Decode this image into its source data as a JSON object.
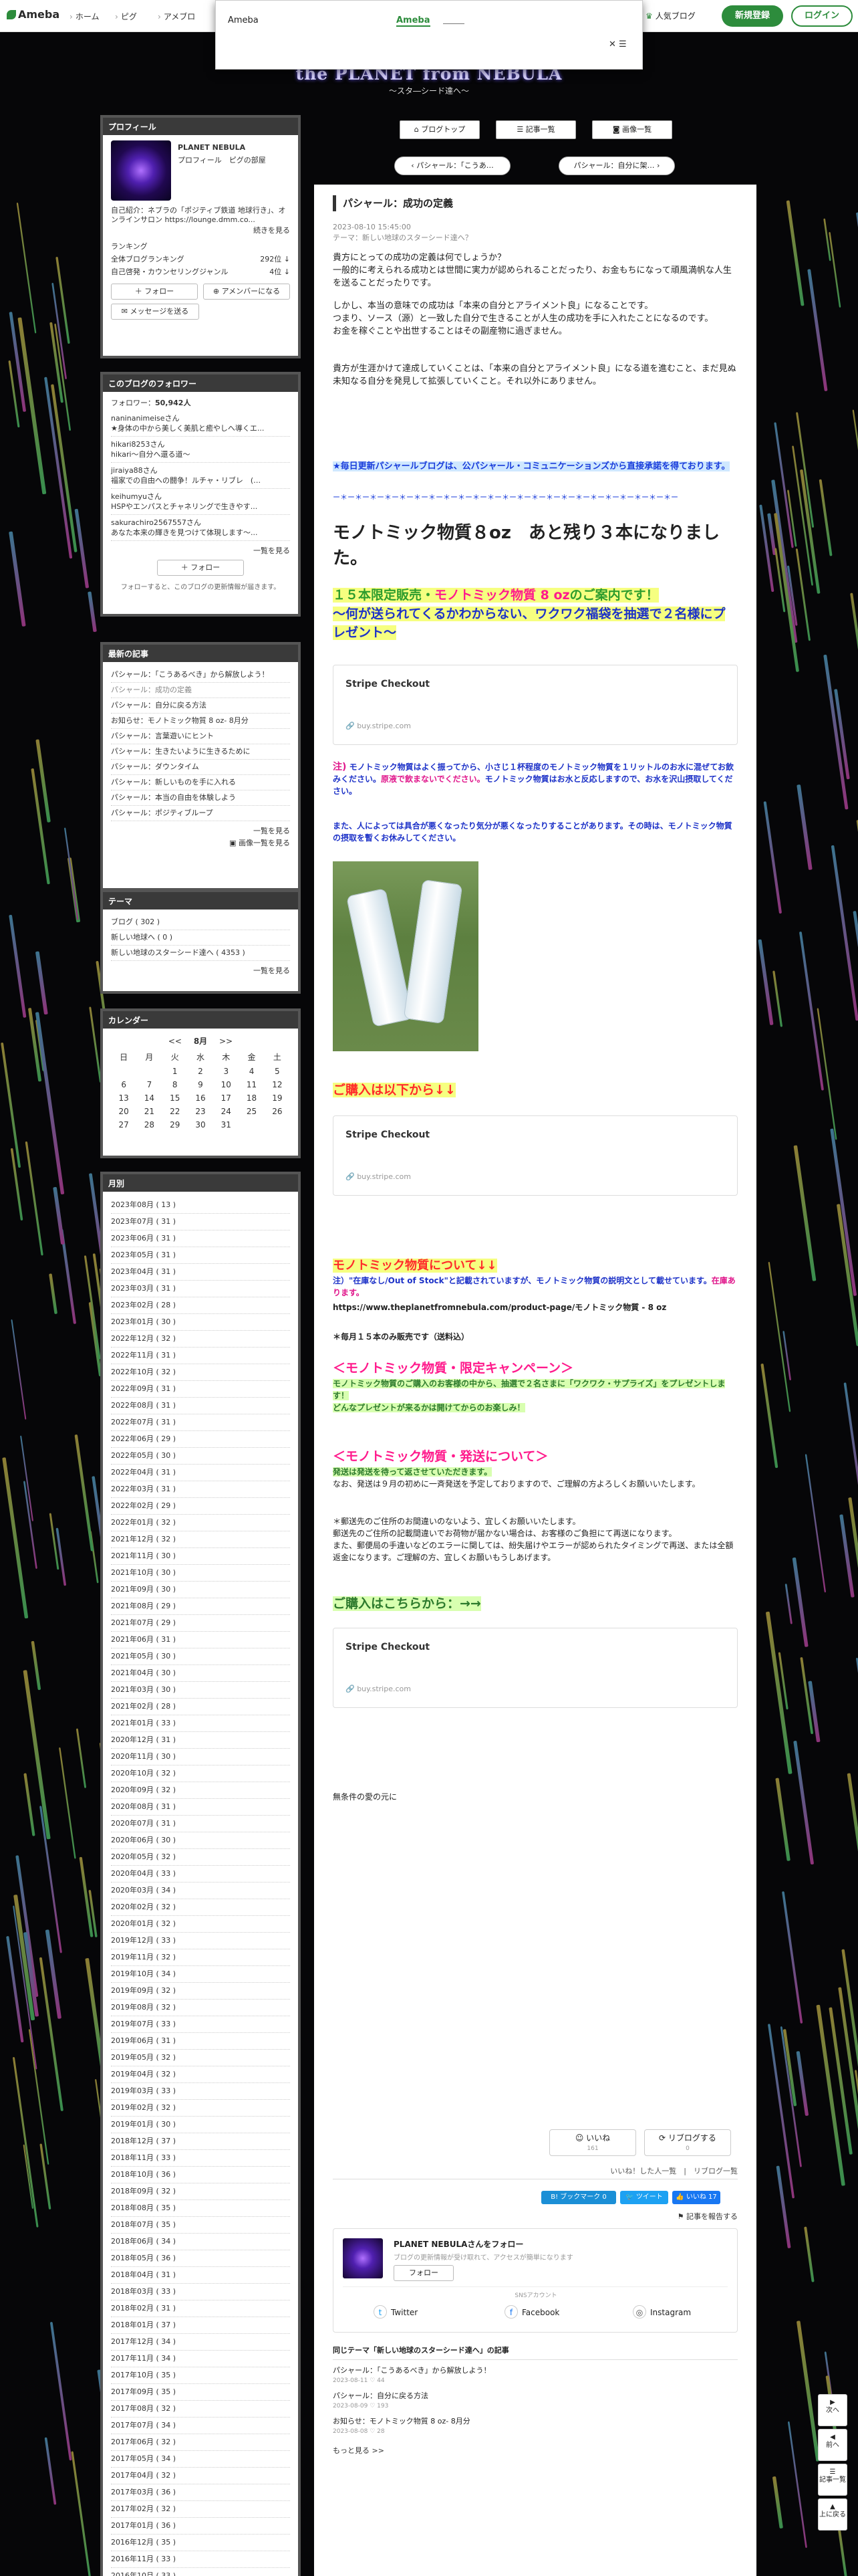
{
  "header": {
    "logo": "Ameba",
    "nav": [
      "ホーム",
      "ピグ",
      "アメブロ"
    ],
    "popular": "人気ブログ",
    "signup": "新規登録",
    "login": "ログイン",
    "popup_title": "Ameba",
    "popup_link": "Ameba",
    "popup_close": "✕ ☰"
  },
  "blog": {
    "title": "the PLANET from NEBULA",
    "subtitle": "〜スタ―シード達へ〜"
  },
  "topnav": {
    "blog_top": "ブログトップ",
    "articles": "記事一覧",
    "images": "画像一覧",
    "prev": "パシャール：「こうあ…",
    "next": "パシャール：自分に架…"
  },
  "profile": {
    "header": "プロフィール",
    "name": "PLANET NEBULA",
    "links": "プロフィール　ピグの部屋",
    "intro": "自己紹介：ネブラの「ポジティブ鉄道 地球行き」、オンラインサロン https://lounge.dmm.co...",
    "intro_more": "続きを見る",
    "ranking_label": "ランキング",
    "rank1_label": "全体ブログランキング",
    "rank1_value": "292位 ↓",
    "rank2_label": "自己啓発・カウンセリングジャンル",
    "rank2_value": "4位 ↓",
    "follow_btn": "フォロー",
    "amember_btn": "アメンバーになる",
    "message_btn": "メッセージを送る"
  },
  "followers": {
    "header": "このブログのフォロワー",
    "count_label": "フォロワー：",
    "count": "50,942人",
    "items": [
      {
        "name": "naninanimeiseさん",
        "text": "★身体の中から美しく美肌と癒やしへ導くエ..."
      },
      {
        "name": "hikari8253さん",
        "text": "hikari～自分へ還る道～"
      },
      {
        "name": "jiraiya88さん",
        "text": "福家での自由への闘争！ルチャ・リブレ　(…"
      },
      {
        "name": "keihumyuさん",
        "text": "HSPやエンパスとチャネリングで生きやす..."
      },
      {
        "name": "sakurachiro2567557さん",
        "text": "あなた本来の輝きを見つけて体現します〜..."
      }
    ],
    "more": "一覧を見る",
    "follow_btn": "フォロー",
    "note": "フォローすると、このブログの更新情報が届きます。"
  },
  "recent": {
    "header": "最新の記事",
    "items": [
      "パシャール：「こうあるべき」から解放しよう！",
      "パシャール：成功の定義",
      "パシャール：自分に戻る方法",
      "お知らせ：モノトミック物質 8 oz- 8月分",
      "パシャール：言葉遊いにヒント",
      "パシャール：生きたいように生きるために",
      "パシャール：ダウンタイム",
      "パシャール：新しいものを手に入れる",
      "パシャール：本当の自由を体験しよう",
      "パシャール：ポジティブループ"
    ],
    "current_index": 1,
    "more": "一覧を見る",
    "images_more": "画像一覧を見る"
  },
  "theme": {
    "header": "テーマ",
    "items": [
      "ブログ ( 302 )",
      "新しい地球へ ( 0 )",
      "新しい地球のスターシード達へ ( 4353 )"
    ],
    "more": "一覧を見る"
  },
  "calendar": {
    "header": "カレンダー",
    "prev": "<<",
    "month": "8月",
    "next": ">>",
    "weekdays": [
      "日",
      "月",
      "火",
      "水",
      "木",
      "金",
      "土"
    ],
    "weeks": [
      [
        "",
        "",
        "1",
        "2",
        "3",
        "4",
        "5"
      ],
      [
        "6",
        "7",
        "8",
        "9",
        "10",
        "11",
        "12"
      ],
      [
        "13",
        "14",
        "15",
        "16",
        "17",
        "18",
        "19"
      ],
      [
        "20",
        "21",
        "22",
        "23",
        "24",
        "25",
        "26"
      ],
      [
        "27",
        "28",
        "29",
        "30",
        "31",
        "",
        ""
      ]
    ]
  },
  "monthly": {
    "header": "月別",
    "items": [
      "2023年08月 ( 13 )",
      "2023年07月 ( 31 )",
      "2023年06月 ( 31 )",
      "2023年05月 ( 31 )",
      "2023年04月 ( 31 )",
      "2023年03月 ( 31 )",
      "2023年02月 ( 28 )",
      "2023年01月 ( 30 )",
      "2022年12月 ( 32 )",
      "2022年11月 ( 31 )",
      "2022年10月 ( 32 )",
      "2022年09月 ( 31 )",
      "2022年08月 ( 31 )",
      "2022年07月 ( 31 )",
      "2022年06月 ( 29 )",
      "2022年05月 ( 30 )",
      "2022年04月 ( 31 )",
      "2022年03月 ( 31 )",
      "2022年02月 ( 29 )",
      "2022年01月 ( 32 )",
      "2021年12月 ( 32 )",
      "2021年11月 ( 30 )",
      "2021年10月 ( 30 )",
      "2021年09月 ( 30 )",
      "2021年08月 ( 29 )",
      "2021年07月 ( 29 )",
      "2021年06月 ( 31 )",
      "2021年05月 ( 30 )",
      "2021年04月 ( 30 )",
      "2021年03月 ( 30 )",
      "2021年02月 ( 28 )",
      "2021年01月 ( 33 )",
      "2020年12月 ( 31 )",
      "2020年11月 ( 30 )",
      "2020年10月 ( 32 )",
      "2020年09月 ( 32 )",
      "2020年08月 ( 31 )",
      "2020年07月 ( 31 )",
      "2020年06月 ( 30 )",
      "2020年05月 ( 32 )",
      "2020年04月 ( 33 )",
      "2020年03月 ( 34 )",
      "2020年02月 ( 32 )",
      "2020年01月 ( 32 )",
      "2019年12月 ( 33 )",
      "2019年11月 ( 32 )",
      "2019年10月 ( 34 )",
      "2019年09月 ( 32 )",
      "2019年08月 ( 32 )",
      "2019年07月 ( 33 )",
      "2019年06月 ( 31 )",
      "2019年05月 ( 32 )",
      "2019年04月 ( 32 )",
      "2019年03月 ( 33 )",
      "2019年02月 ( 32 )",
      "2019年01月 ( 30 )",
      "2018年12月 ( 37 )",
      "2018年11月 ( 33 )",
      "2018年10月 ( 36 )",
      "2018年09月 ( 32 )",
      "2018年08月 ( 35 )",
      "2018年07月 ( 35 )",
      "2018年06月 ( 34 )",
      "2018年05月 ( 36 )",
      "2018年04月 ( 31 )",
      "2018年03月 ( 33 )",
      "2018年02月 ( 31 )",
      "2018年01月 ( 37 )",
      "2017年12月 ( 34 )",
      "2017年11月 ( 34 )",
      "2017年10月 ( 35 )",
      "2017年09月 ( 35 )",
      "2017年08月 ( 32 )",
      "2017年07月 ( 34 )",
      "2017年06月 ( 32 )",
      "2017年05月 ( 34 )",
      "2017年04月 ( 32 )",
      "2017年03月 ( 36 )",
      "2017年02月 ( 32 )",
      "2017年01月 ( 36 )",
      "2016年12月 ( 35 )",
      "2016年11月 ( 33 )",
      "2016年10月 ( 33 )"
    ]
  },
  "article": {
    "title": "パシャール：成功の定義",
    "date": "2023-08-10 15:45:00",
    "theme": "テーマ：新しい地球のスターシード達へ？",
    "p1": "貴方にとっての成功の定義は何でしょうか？\n一般的に考えられる成功とは世間に実力が認められることだったり、お金もちになって頑風満帆な人生を送ることだったりです。",
    "p2": "しかし、本当の意味での成功は「本来の自分とアライメント良」になることです。\nつまり、ソース（源）と一致した自分で生きることが人生の成功を手に入れたことになるのです。\nお金を稼ぐことや出世することはその副産物に過ぎません。",
    "p3": "貴方が生涯かけて達成していくことは、「本来の自分とアライメント良」になる道を進むこと、まだ見ぬ未知なる自分を発見して拡張していくこと。それ以外にありません。",
    "notice": "★毎日更新パシャールブログは、公パシャール・コミュニケーションズから直接承諾を得ております。",
    "divider": "ー＊ー＊ー＊ー＊ー＊ー＊ー＊ー＊ー＊ー＊ー＊ー＊ー＊ー＊ー＊ー＊ー＊ー＊ー＊ー＊ー＊ー＊ー＊ー",
    "h1": "モノトミック物質８oz　あと残り３本になりました。",
    "h2a": "１５本限定販売・",
    "h2b": "モノトミック物質 8 oz",
    "h2c": "のご案内です！",
    "h2d": "〜何が送られてくるかわからない、ワクワク福袋を抽選で２名様にプレゼント〜",
    "stripe_title": "Stripe Checkout",
    "stripe_url": "buy.stripe.com",
    "note_label": "注)",
    "note1": "モノトミック物質はよく振ってから、小さじ１杯程度のモノトミック物質を１リットルのお水に混ぜてお飲みください。",
    "note1_red": "原液で飲まないでください。",
    "note1b": "モノトミック物質はお水と反応しますので、お水を沢山摂取してください。",
    "note2": "また、人によっては具合が悪くなったり気分が悪くなったりすることがあります。その時は、モノトミック物質の摂取を暫くお休みしてください。",
    "buy_heading": "ご購入は以下から↓↓",
    "about_heading": "モノトミック物質について↓↓",
    "about1": "注）\"在庫なし/Out of Stock\"と記載されていますが、モノトミック物質の説明文として載せています。",
    "about1_red": "在庫あります。",
    "about_url": "https://www.theplanetfromnebula.com/product-page/モノトミック物質 - 8 oz",
    "about2": "＊毎月１５本のみ販売です（送料込）",
    "campaign_heading": "＜モノトミック物質・限定キャンペーン＞",
    "campaign_text": "モノトミック物質のご購入のお客様の中から、抽選で２名さまに「ワクワク・サプライズ」をプレゼントします！\nどんなプレゼントが来るかは開けてからのお楽しみ！",
    "ship_heading": "＜モノトミック物質・発送について＞",
    "ship1": "発送は発送を待って返させていただきます。",
    "ship2": "なお、発送は９月の初めに一斉発送を予定しておりますので、ご理解の方よろしくお願いいたします。",
    "ship3": "＊郵送先のご住所のお間違いのないよう、宜しくお願いいたします。\n郵送先のご住所の記載間違いでお荷物が届かない場合は、お客様のご負担にて再送になります。\nまた、郵便局の手違いなどのエラーに関しては、紛失届けやエラーが認められたタイミングで再送、または全額返金になります。ご理解の方、宜しくお願いもうしあげます。",
    "order_heading": "ご購入はこちらから：→→",
    "closing": "無条件の愛の元に",
    "like_btn": "いいね",
    "like_count": "161",
    "reblog_btn": "リブログする",
    "reblog_count": "0",
    "like_links": "いいね！した人一覧　|　リブログ一覧",
    "bookmark": "B! ブックマーク 0",
    "tweet": "ツイート",
    "fb_like": "いいね 17",
    "report": "記事を報告する",
    "follow_card_title": "PLANET NEBULAさんをフォロー",
    "follow_card_sub": "ブログの更新情報が受け取れて、アクセスが簡単になります",
    "follow_card_btn": "フォロー",
    "sns_label": "SNSアカウント",
    "sns": [
      "Twitter",
      "Facebook",
      "Instagram"
    ],
    "related_header": "同じテーマ「新しい地球のスターシード達へ」の記事",
    "related": [
      {
        "title": "パシャール：「こうあるべき」から解放しよう！",
        "date": "2023-08-11",
        "likes": "44"
      },
      {
        "title": "パシャール：自分に戻る方法",
        "date": "2023-08-09",
        "likes": "193"
      },
      {
        "title": "お知らせ：モノトミック物質 8 oz- 8月分",
        "date": "2023-08-08",
        "likes": "28"
      }
    ],
    "related_more": "もっと見る >>"
  },
  "rightnav": {
    "next": "次へ",
    "prev": "前へ",
    "list": "記事一覧",
    "top": "上に戻る"
  },
  "colors": {
    "accent": "#2d8c3c",
    "link_blue": "#1a3ddb",
    "pink": "#ff1a8c",
    "red": "#e0224a"
  }
}
